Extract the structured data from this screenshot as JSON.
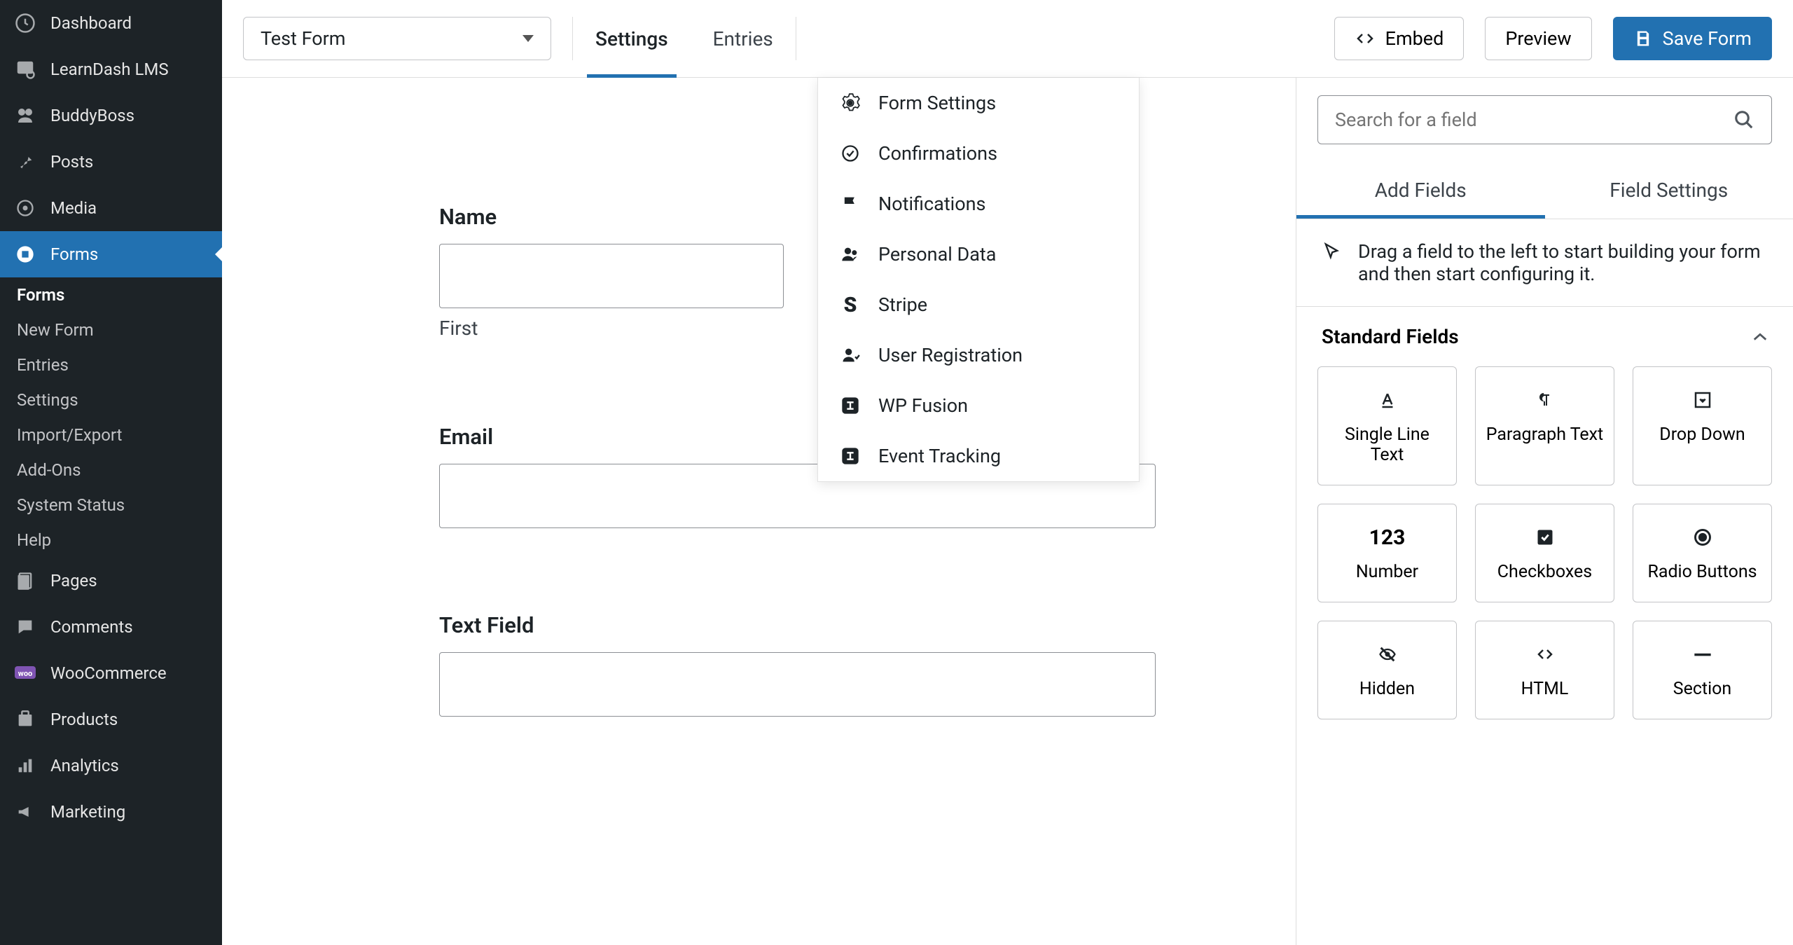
{
  "sidebar": {
    "items": [
      {
        "label": "Dashboard"
      },
      {
        "label": "LearnDash LMS"
      },
      {
        "label": "BuddyBoss"
      },
      {
        "label": "Posts"
      },
      {
        "label": "Media"
      },
      {
        "label": "Forms"
      },
      {
        "label": "Pages"
      },
      {
        "label": "Comments"
      },
      {
        "label": "WooCommerce"
      },
      {
        "label": "Products"
      },
      {
        "label": "Analytics"
      },
      {
        "label": "Marketing"
      }
    ],
    "submenu": [
      {
        "label": "Forms"
      },
      {
        "label": "New Form"
      },
      {
        "label": "Entries"
      },
      {
        "label": "Settings"
      },
      {
        "label": "Import/Export"
      },
      {
        "label": "Add-Ons"
      },
      {
        "label": "System Status"
      },
      {
        "label": "Help"
      }
    ]
  },
  "toolbar": {
    "form_name": "Test Form",
    "tabs": {
      "settings": "Settings",
      "entries": "Entries"
    },
    "embed": "Embed",
    "preview": "Preview",
    "save": "Save Form"
  },
  "dropdown": {
    "items": [
      {
        "label": "Form Settings"
      },
      {
        "label": "Confirmations"
      },
      {
        "label": "Notifications"
      },
      {
        "label": "Personal Data"
      },
      {
        "label": "Stripe"
      },
      {
        "label": "User Registration"
      },
      {
        "label": "WP Fusion"
      },
      {
        "label": "Event Tracking"
      }
    ]
  },
  "form": {
    "name_label": "Name",
    "first_label": "First",
    "email_label": "Email",
    "text_label": "Text Field"
  },
  "panel": {
    "search_placeholder": "Search for a field",
    "tab_add": "Add Fields",
    "tab_settings": "Field Settings",
    "hint": "Drag a field to the left to start building your form and then start configuring it.",
    "section_standard": "Standard Fields",
    "fields": [
      {
        "label": "Single Line Text"
      },
      {
        "label": "Paragraph Text"
      },
      {
        "label": "Drop Down"
      },
      {
        "label": "Number"
      },
      {
        "label": "Checkboxes"
      },
      {
        "label": "Radio Buttons"
      },
      {
        "label": "Hidden"
      },
      {
        "label": "HTML"
      },
      {
        "label": "Section"
      }
    ]
  }
}
